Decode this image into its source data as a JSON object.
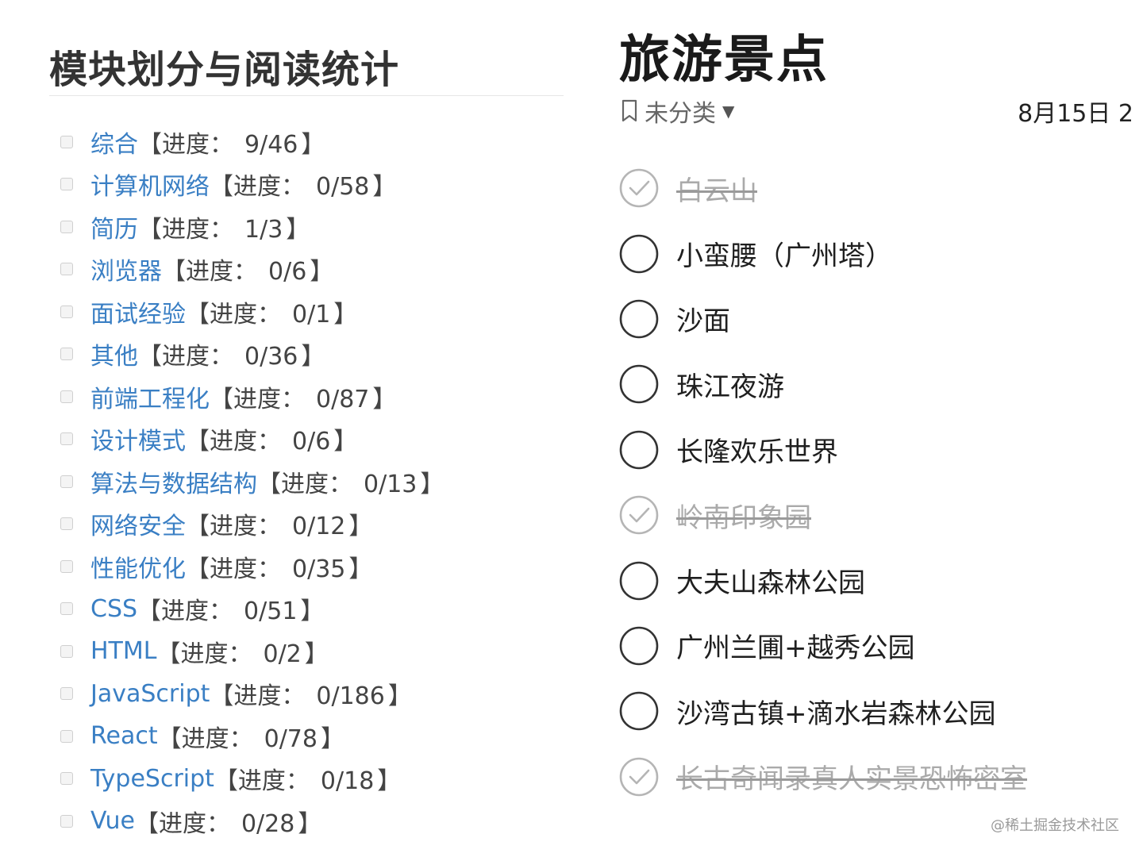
{
  "left_panel": {
    "title": "模块划分与阅读统计",
    "progress_prefix": "【进度：",
    "progress_suffix": "】",
    "modules": [
      {
        "name": "综合",
        "progress": "9/46"
      },
      {
        "name": "计算机网络",
        "progress": "0/58"
      },
      {
        "name": "简历",
        "progress": "1/3"
      },
      {
        "name": "浏览器",
        "progress": "0/6"
      },
      {
        "name": "面试经验",
        "progress": "0/1"
      },
      {
        "name": "其他",
        "progress": "0/36"
      },
      {
        "name": "前端工程化",
        "progress": "0/87"
      },
      {
        "name": "设计模式",
        "progress": "0/6"
      },
      {
        "name": "算法与数据结构",
        "progress": "0/13"
      },
      {
        "name": "网络安全",
        "progress": "0/12"
      },
      {
        "name": "性能优化",
        "progress": "0/35"
      },
      {
        "name": "CSS",
        "progress": "0/51"
      },
      {
        "name": "HTML",
        "progress": "0/2"
      },
      {
        "name": "JavaScript",
        "progress": "0/186"
      },
      {
        "name": "React",
        "progress": "0/78"
      },
      {
        "name": "TypeScript",
        "progress": "0/18"
      },
      {
        "name": "Vue",
        "progress": "0/28"
      }
    ]
  },
  "right_panel": {
    "title": "旅游景点",
    "category": "未分类",
    "category_icon": "bookmark-icon",
    "date": "8月15日 2",
    "todos": [
      {
        "text": "白云山",
        "done": true
      },
      {
        "text": "小蛮腰（广州塔）",
        "done": false
      },
      {
        "text": "沙面",
        "done": false
      },
      {
        "text": "珠江夜游",
        "done": false
      },
      {
        "text": "长隆欢乐世界",
        "done": false
      },
      {
        "text": "岭南印象园",
        "done": true
      },
      {
        "text": "大夫山森林公园",
        "done": false
      },
      {
        "text": "广州兰圃+越秀公园",
        "done": false
      },
      {
        "text": "沙湾古镇+滴水岩森林公园",
        "done": false
      },
      {
        "text": "长古奇闻录真人实景恐怖密室",
        "done": true
      }
    ]
  },
  "watermark": "@稀土掘金技术社区",
  "colors": {
    "link": "#3a7fc4",
    "done_text": "#aaaaaa",
    "circle": "#333333",
    "circle_done": "#b5b5b5"
  }
}
